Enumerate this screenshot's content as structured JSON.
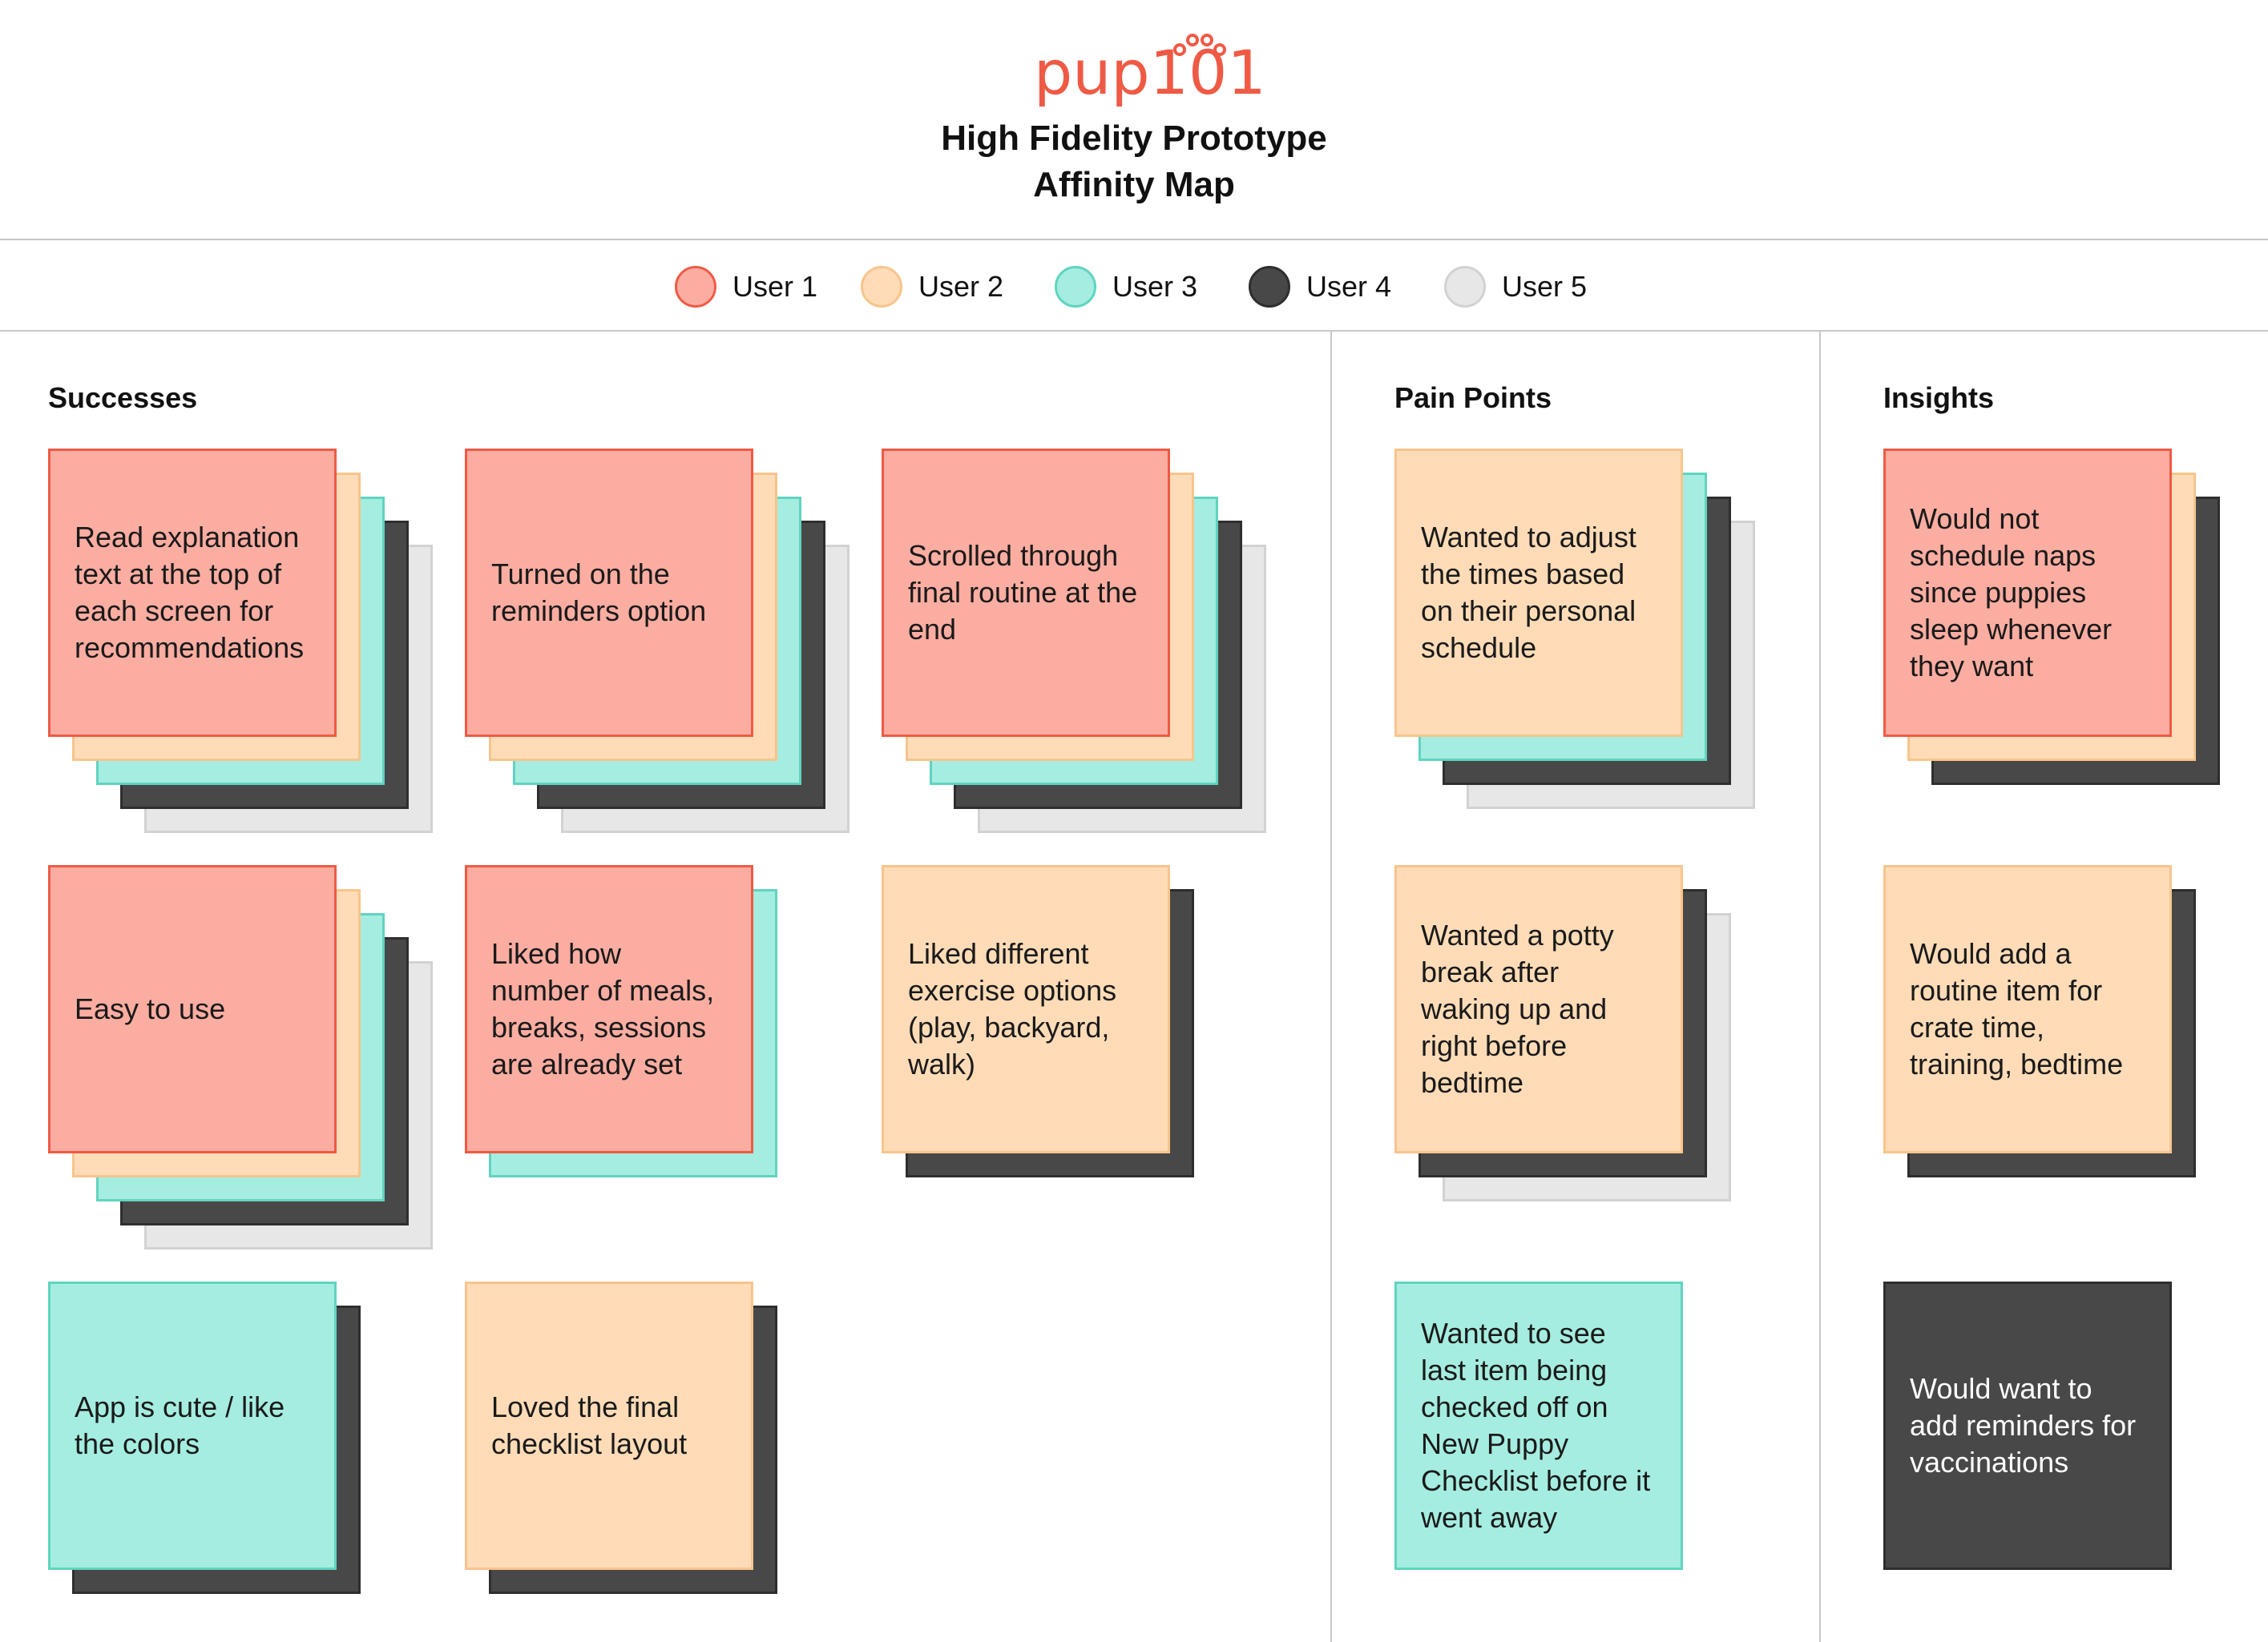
{
  "header": {
    "logo": {
      "word": "pup",
      "number": "101"
    },
    "title_line1": "High Fidelity Prototype",
    "title_line2": "Affinity Map"
  },
  "legend": [
    {
      "label": "User 1",
      "color": "#fbada1",
      "border": "#ef5a45"
    },
    {
      "label": "User 2",
      "color": "#ffdcb7",
      "border": "#f8c48c"
    },
    {
      "label": "User 3",
      "color": "#a5ede0",
      "border": "#5fd4c0"
    },
    {
      "label": "User 4",
      "color": "#484848",
      "border": "#2e2e2e"
    },
    {
      "label": "User 5",
      "color": "#e7e7e7",
      "border": "#d2d2d2"
    }
  ],
  "sections": {
    "successes": {
      "title": "Successes",
      "notes": [
        {
          "text": "Read explanation text at the top of each screen for recommendations",
          "users": [
            1,
            2,
            3,
            4,
            5
          ]
        },
        {
          "text": "Turned on the reminders option",
          "users": [
            1,
            2,
            3,
            4,
            5
          ]
        },
        {
          "text": "Scrolled through final routine at the end",
          "users": [
            1,
            2,
            3,
            4,
            5
          ]
        },
        {
          "text": "Easy to use",
          "users": [
            1,
            2,
            3,
            4,
            5
          ]
        },
        {
          "text": "Liked how number of meals, breaks, sessions are already set",
          "users": [
            1,
            3
          ]
        },
        {
          "text": "Liked different exercise options (play, backyard, walk)",
          "users": [
            2,
            4
          ]
        },
        {
          "text": "App is cute / like the colors",
          "users": [
            3,
            4
          ]
        },
        {
          "text": "Loved the final checklist layout",
          "users": [
            2,
            4
          ]
        }
      ]
    },
    "pain_points": {
      "title": "Pain Points",
      "notes": [
        {
          "text": "Wanted to adjust the times based on their personal schedule",
          "users": [
            2,
            3,
            4,
            5
          ]
        },
        {
          "text": "Wanted a potty break after waking up and right before bedtime",
          "users": [
            2,
            4,
            5
          ]
        },
        {
          "text": "Wanted to see last item being checked off on New Puppy Checklist before it went away",
          "users": [
            3
          ]
        }
      ]
    },
    "insights": {
      "title": "Insights",
      "notes": [
        {
          "text": "Would not schedule naps since puppies sleep whenever they want",
          "users": [
            1,
            2,
            4
          ]
        },
        {
          "text": "Would add a routine item for crate time, training, bedtime",
          "users": [
            2,
            4
          ]
        },
        {
          "text": "Would want to add reminders for vaccinations",
          "users": [
            4
          ]
        }
      ]
    }
  }
}
